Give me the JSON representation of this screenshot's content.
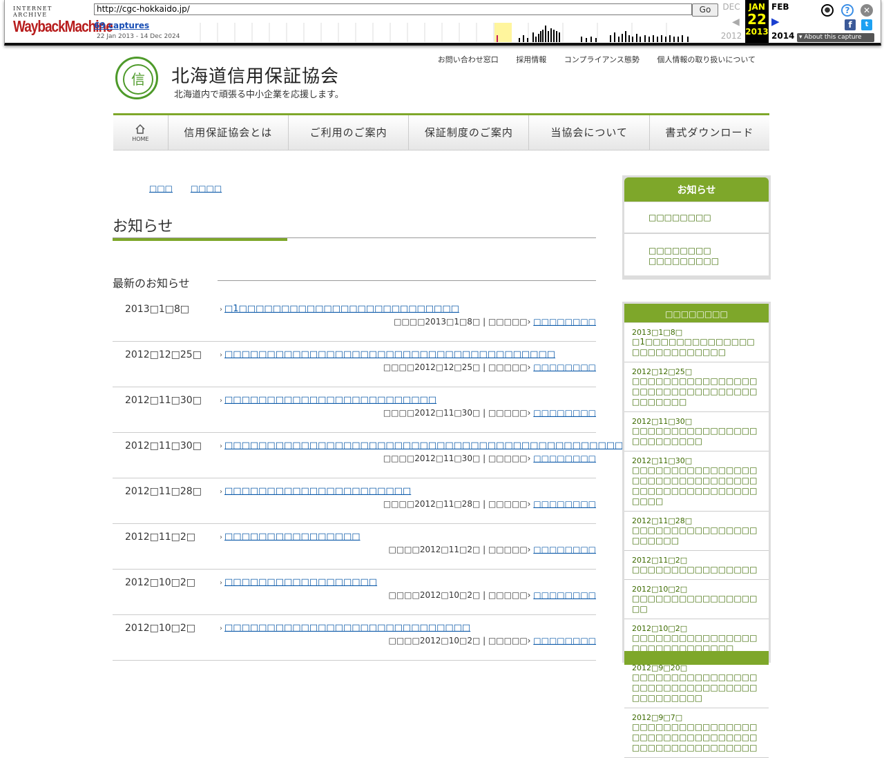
{
  "wayback": {
    "logo_top": "INTERNET ARCHIVE",
    "logo_main": "WaybackMachine",
    "url": "http://cgc-hokkaido.jp/",
    "go_label": "Go",
    "captures": "69 captures",
    "date_range": "22 Jan 2013 - 14 Dec 2024",
    "prev_month": "DEC",
    "prev_year": "2012",
    "cur_month": "JAN",
    "cur_day": "22",
    "cur_year": "2013",
    "next_month": "FEB",
    "next_year": "2014",
    "about": "About this capture"
  },
  "header": {
    "site_name": "北海道信用保証協会",
    "tagline": "北海道内で頑張る中小企業を応援します。",
    "logo_char": "信",
    "util_links": [
      "お問い合わせ窓口",
      "採用情報",
      "コンプライアンス態勢",
      "個人情報の取り扱いについて"
    ]
  },
  "nav": {
    "home": "HOME",
    "items": [
      "信用保証協会とは",
      "ご利用のご案内",
      "保証制度のご案内",
      "当協会について",
      "書式ダウンロード"
    ]
  },
  "breadcrumb": [
    "□□□",
    "□□□□"
  ],
  "page_title": "お知らせ",
  "section_title": "最新のお知らせ",
  "news": [
    {
      "date": "2013□1□8□",
      "title": "□1□□□□□□□□□□□□□□□□□□□□□□□□□□",
      "meta": "□□□□2013□1□8□ | □□□□□",
      "cat": "□□□□□□□□"
    },
    {
      "date": "2012□12□25□",
      "title": "□□□□□□□□□□□□□□□□□□□□□□□□□□□□□□□□□□□□□□□",
      "meta": "□□□□2012□12□25□ | □□□□□",
      "cat": "□□□□□□□□"
    },
    {
      "date": "2012□11□30□",
      "title": "□□□□□□□□□□□□□□□□□□□□□□□□□",
      "meta": "□□□□2012□11□30□ | □□□□□",
      "cat": "□□□□□□□□"
    },
    {
      "date": "2012□11□30□",
      "title": "□□□□□□□□□□□□□□□□□□□□□□□□□□□□□□□□□□□□□□□□□□□□□□□□□□□□",
      "meta": "□□□□2012□11□30□ | □□□□□",
      "cat": "□□□□□□□□"
    },
    {
      "date": "2012□11□28□",
      "title": "□□□□□□□□□□□□□□□□□□□□□□",
      "meta": "□□□□2012□11□28□ | □□□□□",
      "cat": "□□□□□□□□"
    },
    {
      "date": "2012□11□2□",
      "title": "□□□□□□□□□□□□□□□□",
      "meta": "□□□□2012□11□2□ | □□□□□",
      "cat": "□□□□□□□□"
    },
    {
      "date": "2012□10□2□",
      "title": "□□□□□□□□□□□□□□□□□□",
      "meta": "□□□□2012□10□2□ | □□□□□",
      "cat": "□□□□□□□□"
    },
    {
      "date": "2012□10□2□",
      "title": "□□□□□□□□□□□□□□□□□□□□□□□□□□□□□",
      "meta": "□□□□2012□10□2□ | □□□□□",
      "cat": "□□□□□□□□"
    }
  ],
  "sidebar": {
    "box1_title": "お知らせ",
    "box1_items": [
      "□□□□□□□□",
      "□□□□□□□□\n□□□□□□□□□"
    ],
    "box2_title": "□□□□□□□□",
    "box2_items": [
      {
        "date": "2013□1□8□",
        "title": "□1□□□□□□□□□□□□□□□□□□□□□□□□□□"
      },
      {
        "date": "2012□12□25□",
        "title": "□□□□□□□□□□□□□□□□□□□□□□□□□□□□□□□□□□□□□□□"
      },
      {
        "date": "2012□11□30□",
        "title": "□□□□□□□□□□□□□□□□□□□□□□□□□"
      },
      {
        "date": "2012□11□30□",
        "title": "□□□□□□□□□□□□□□□□□□□□□□□□□□□□□□□□□□□□□□□□□□□□□□□□□□□□"
      },
      {
        "date": "2012□11□28□",
        "title": "□□□□□□□□□□□□□□□□□□□□□□"
      },
      {
        "date": "2012□11□2□",
        "title": "□□□□□□□□□□□□□□□□"
      },
      {
        "date": "2012□10□2□",
        "title": "□□□□□□□□□□□□□□□□□□"
      },
      {
        "date": "2012□10□2□",
        "title": "□□□□□□□□□□□□□□□□□□□□□□□□□□□□□"
      },
      {
        "date": "2012□9□20□",
        "title": "□□□□□□□□□□□□□□□□□□□□□□□□□□□□□□□□□□□□□□□□□"
      },
      {
        "date": "2012□9□7□",
        "title": "□□□□□□□□□□□□□□□□ □□□□□□□□□□□□□□□□□□□□□□□□□□□□□□□□"
      }
    ]
  },
  "colors": {
    "accent": "#7ea72a",
    "link": "#0a58a8",
    "side_text": "#3d6b00"
  }
}
